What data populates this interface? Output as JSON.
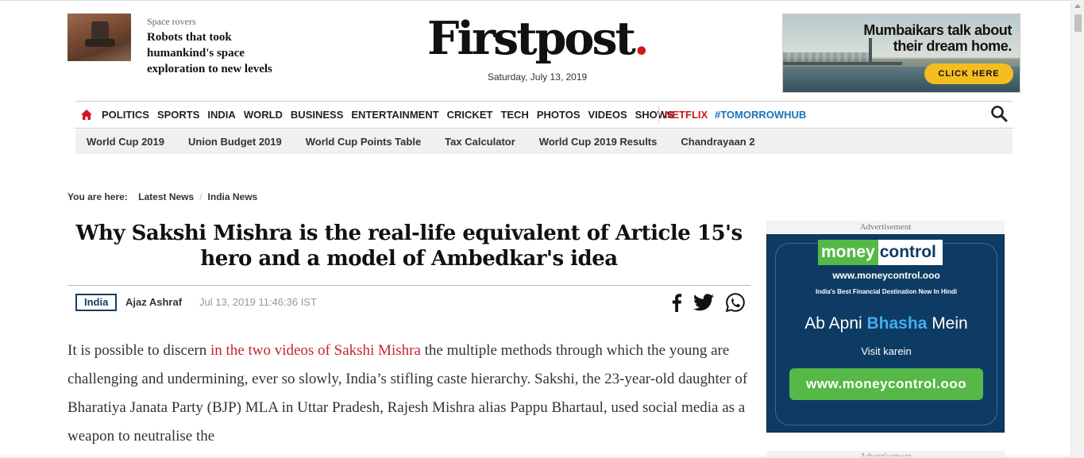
{
  "promo": {
    "kicker": "Space rovers",
    "title": "Robots that took humankind's space exploration to new levels"
  },
  "logo": {
    "text": "Firstpost",
    "dot": "."
  },
  "date": "Saturday, July 13, 2019",
  "top_ad": {
    "headline": "Mumbaikars talk about their dream home.",
    "cta": "CLICK HERE"
  },
  "nav": {
    "items": [
      "POLITICS",
      "SPORTS",
      "INDIA",
      "WORLD",
      "BUSINESS",
      "ENTERTAINMENT",
      "CRICKET",
      "TECH",
      "PHOTOS",
      "VIDEOS",
      "SHOWS"
    ],
    "netflix": "NETFLIX",
    "hub": "#TOMORROWHUB",
    "accent": "#d0161d",
    "hub_color": "#1d74b5"
  },
  "subnav": {
    "items": [
      "World Cup 2019",
      "Union Budget 2019",
      "World Cup Points Table",
      "Tax Calculator",
      "World Cup 2019 Results",
      "Chandrayaan 2"
    ]
  },
  "breadcrumb": {
    "label": "You are here:",
    "items": [
      "Latest News",
      "India News"
    ]
  },
  "article": {
    "title": "Why Sakshi Mishra is the real-life equivalent of Article 15's hero and a model of Ambedkar's idea",
    "category": "India",
    "author": "Ajaz Ashraf",
    "timestamp": "Jul 13, 2019 11:46:36 IST",
    "share_icons": [
      "facebook-icon",
      "twitter-icon",
      "whatsapp-icon"
    ],
    "body_before_link": "It is possible to discern ",
    "body_link": "in the two videos of Sakshi Mishra",
    "body_after_link": " the multiple methods through which the young are challenging and undermining, ever so slowly, India’s stifling caste hierarchy. Sakshi, the 23-year-old daughter of Bharatiya Janata Party (BJP) MLA in Uttar Pradesh, Rajesh Mishra alias Pappu Bhartaul, used social media as a weapon to neutralise the"
  },
  "side_ad": {
    "label": "Advertisement",
    "brand_money": "money",
    "brand_control": "control",
    "url": "www.moneycontrol.ooo",
    "tagline": "India's Best Financial Destination Now In Hindi",
    "line_before": "Ab Apni ",
    "line_highlight": "Bhasha",
    "line_after": " Mein",
    "visit": "Visit karein",
    "button": "www.moneycontrol.ooo",
    "label2": "Advertisement"
  }
}
